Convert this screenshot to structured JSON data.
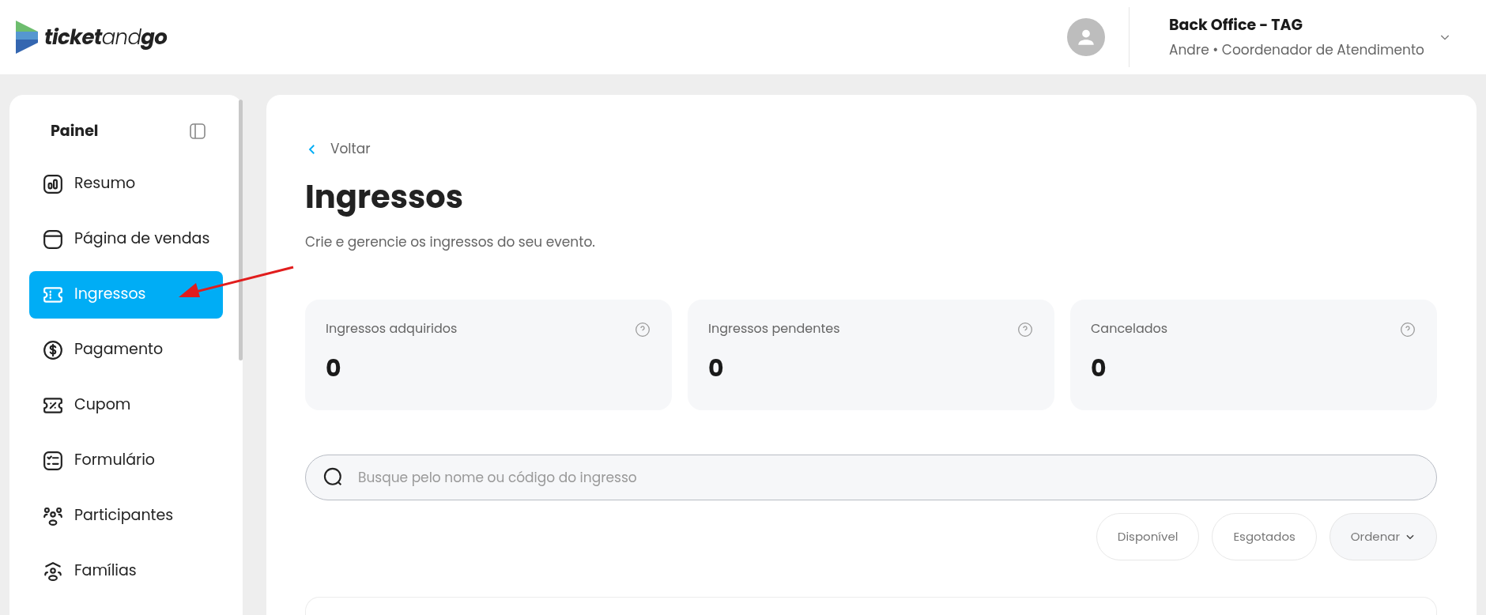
{
  "header": {
    "brand": {
      "bold1": "ticket",
      "light": "and",
      "bold2": "go"
    },
    "account": {
      "title": "Back Office - TAG",
      "subtitle": "Andre • Coordenador de Atendimento"
    }
  },
  "sidebar": {
    "title": "Painel",
    "items": [
      {
        "label": "Resumo",
        "selected": false
      },
      {
        "label": "Página de vendas",
        "selected": false
      },
      {
        "label": "Ingressos",
        "selected": true
      },
      {
        "label": "Pagamento",
        "selected": false
      },
      {
        "label": "Cupom",
        "selected": false
      },
      {
        "label": "Formulário",
        "selected": false
      },
      {
        "label": "Participantes",
        "selected": false
      },
      {
        "label": "Famílias",
        "selected": false
      }
    ]
  },
  "main": {
    "back": "Voltar",
    "title": "Ingressos",
    "subtitle": "Crie e gerencie os ingressos do seu evento.",
    "stats": [
      {
        "label": "Ingressos adquiridos",
        "value": "0"
      },
      {
        "label": "Ingressos pendentes",
        "value": "0"
      },
      {
        "label": "Cancelados",
        "value": "0"
      }
    ],
    "search": {
      "placeholder": "Busque pelo nome ou código do ingresso"
    },
    "filters": [
      {
        "label": "Disponível",
        "kind": "toggle"
      },
      {
        "label": "Esgotados",
        "kind": "toggle"
      },
      {
        "label": "Ordenar",
        "kind": "dropdown"
      }
    ]
  }
}
